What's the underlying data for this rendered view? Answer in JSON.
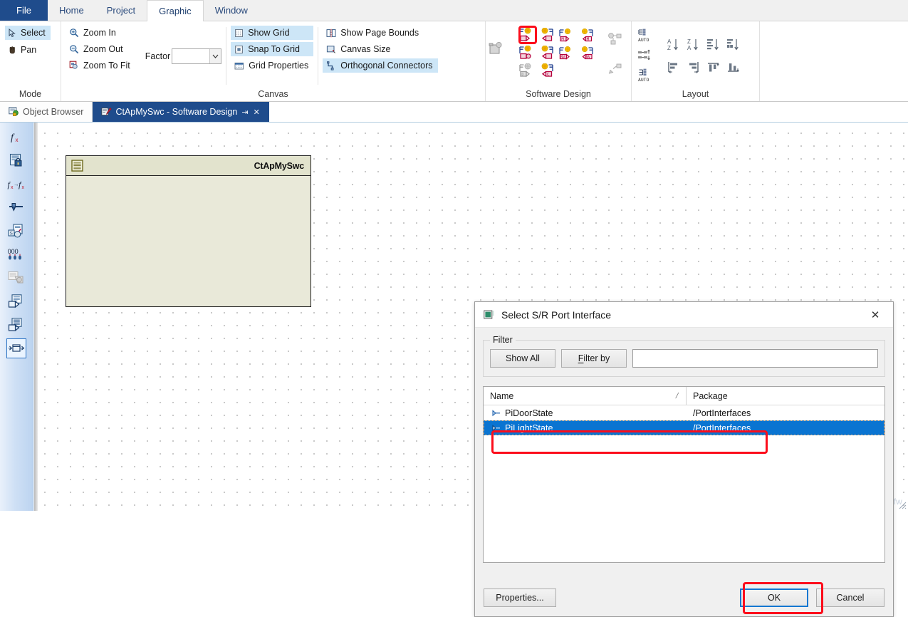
{
  "ribbon": {
    "tabs": [
      {
        "label": "File",
        "state": "file"
      },
      {
        "label": "Home",
        "state": "normal"
      },
      {
        "label": "Project",
        "state": "normal"
      },
      {
        "label": "Graphic",
        "state": "active"
      },
      {
        "label": "Window",
        "state": "normal"
      }
    ],
    "groups": {
      "mode": {
        "title": "Mode",
        "items": [
          {
            "label": "Select",
            "icon": "cursor-arrow-icon",
            "selected": true
          },
          {
            "label": "Pan",
            "icon": "hand-icon",
            "selected": false
          }
        ]
      },
      "canvas": {
        "title": "Canvas",
        "zoom_items": [
          {
            "label": "Zoom In",
            "icon": "zoom-in-icon"
          },
          {
            "label": "Zoom Out",
            "icon": "zoom-out-icon"
          },
          {
            "label": "Zoom To Fit",
            "icon": "zoom-to-fit-icon"
          }
        ],
        "factor_label": "Factor",
        "factor_value": "",
        "factor_placeholder": "",
        "grid_items": [
          {
            "label": "Show Grid",
            "icon": "grid-icon",
            "highlighted": true
          },
          {
            "label": "Snap To Grid",
            "icon": "snap-grid-icon",
            "highlighted": true
          },
          {
            "label": "Grid Properties",
            "icon": "grid-properties-icon",
            "highlighted": false
          }
        ],
        "page_items": [
          {
            "label": "Show Page Bounds",
            "icon": "page-bounds-icon",
            "highlighted": false
          },
          {
            "label": "Canvas Size",
            "icon": "canvas-size-icon",
            "highlighted": false
          },
          {
            "label": "Orthogonal Connectors",
            "icon": "orthogonal-connectors-icon",
            "highlighted": true
          }
        ]
      },
      "software_design": {
        "title": "Software Design",
        "side_icon": "new-component-icon",
        "icons": [
          {
            "name": "sr-provided-port-icon",
            "highlighted": true,
            "enabled": true
          },
          {
            "name": "sr-required-port-icon",
            "highlighted": false,
            "enabled": true
          },
          {
            "name": "ms-provided-port-icon",
            "highlighted": false,
            "enabled": true
          },
          {
            "name": "ms-required-port-icon",
            "highlighted": false,
            "enabled": true
          },
          {
            "name": "sr-provided-circle-port-icon",
            "highlighted": false,
            "enabled": true
          },
          {
            "name": "sr-required-circle-port-icon",
            "highlighted": false,
            "enabled": true
          },
          {
            "name": "nv-provided-port-icon",
            "highlighted": false,
            "enabled": true
          },
          {
            "name": "nv-required-port-icon",
            "highlighted": false,
            "enabled": true
          },
          {
            "name": "provided-port-disabled-icon",
            "highlighted": false,
            "enabled": false
          },
          {
            "name": "required-port-grey-icon",
            "highlighted": false,
            "enabled": true
          },
          {
            "name": "",
            "highlighted": false,
            "enabled": true
          },
          {
            "name": "",
            "highlighted": false,
            "enabled": true
          }
        ],
        "extra_icons": [
          {
            "name": "connector-graph-disabled-icon",
            "enabled": false
          },
          {
            "name": "connector-edit-disabled-icon",
            "enabled": false
          }
        ]
      },
      "layout": {
        "title": "Layout",
        "auto_icons": [
          {
            "name": "auto-layout-top-icon"
          },
          {
            "name": "distribute-vertical-icon"
          },
          {
            "name": "auto-layout-bottom-icon"
          }
        ],
        "icons": [
          {
            "name": "sort-a-z-icon"
          },
          {
            "name": "sort-z-a-icon"
          },
          {
            "name": "sort-by-size-icon"
          },
          {
            "name": "sort-by-type-icon"
          },
          {
            "name": "align-left-icon"
          },
          {
            "name": "align-right-icon"
          },
          {
            "name": "align-top-icon"
          },
          {
            "name": "align-bottom-icon"
          }
        ]
      }
    }
  },
  "doc_tabs": [
    {
      "label": "Object Browser",
      "icon": "object-browser-icon",
      "active": false,
      "pin": false,
      "close": false
    },
    {
      "label": "CtApMySwc - Software Design",
      "icon": "software-design-icon",
      "active": true,
      "pin_glyph": "⇥",
      "close_glyph": "✕"
    }
  ],
  "left_toolbar": [
    {
      "name": "function-fx-icon",
      "selected": false
    },
    {
      "name": "locked-document-icon",
      "selected": false
    },
    {
      "name": "fx-to-fx-icon",
      "selected": false
    },
    {
      "name": "slider-handle-icon",
      "selected": false
    },
    {
      "name": "sw-component-check-icon",
      "selected": false
    },
    {
      "name": "data-elements-icon",
      "selected": false
    },
    {
      "name": "copy-stack-disabled-icon",
      "selected": false
    },
    {
      "name": "provided-port-panel-icon",
      "selected": false
    },
    {
      "name": "required-port-panel-icon",
      "selected": false
    },
    {
      "name": "connector-panel-icon",
      "selected": true
    }
  ],
  "canvas": {
    "component": {
      "title": "CtApMySwc",
      "icon": "swc-type-icon"
    }
  },
  "dialog": {
    "title": "Select S/R Port Interface",
    "icon": "dialog-app-icon",
    "close_glyph": "✕",
    "filter": {
      "legend": "Filter",
      "show_all_label": "Show All",
      "filter_by_label": "Filter by",
      "filter_by_mnemonic": "F",
      "input_value": "",
      "input_placeholder": ""
    },
    "list": {
      "columns": [
        {
          "label": "Name",
          "sort_indicator": "/"
        },
        {
          "label": "Package",
          "sort_indicator": ""
        }
      ],
      "rows": [
        {
          "name": "PiDoorState",
          "package": "/PortInterfaces",
          "icon": "port-interface-icon",
          "selected": false
        },
        {
          "name": "PiLightState",
          "package": "/PortInterfaces",
          "icon": "port-interface-icon",
          "selected": true
        }
      ]
    },
    "buttons": {
      "properties_label": "Properties...",
      "ok_label": "OK",
      "cancel_label": "Cancel"
    }
  },
  "annotations": [
    {
      "name": "highlight-sr-port-button",
      "color": "#fc0d1b"
    },
    {
      "name": "highlight-selected-row",
      "color": "#fc0d1b"
    },
    {
      "name": "highlight-ok-button",
      "color": "#fc0d1b"
    }
  ],
  "watermark": "https://blog.csdn.net/xyfx_jffw",
  "colors": {
    "ribbon_file_blue": "#1f4c8c",
    "tab_active_blue": "#1f4c8c",
    "highlight_blue": "#cde6f7",
    "selection_blue": "#0a74d1",
    "annotation_red": "#fc0d1b",
    "component_fill": "#e9e9d9"
  }
}
